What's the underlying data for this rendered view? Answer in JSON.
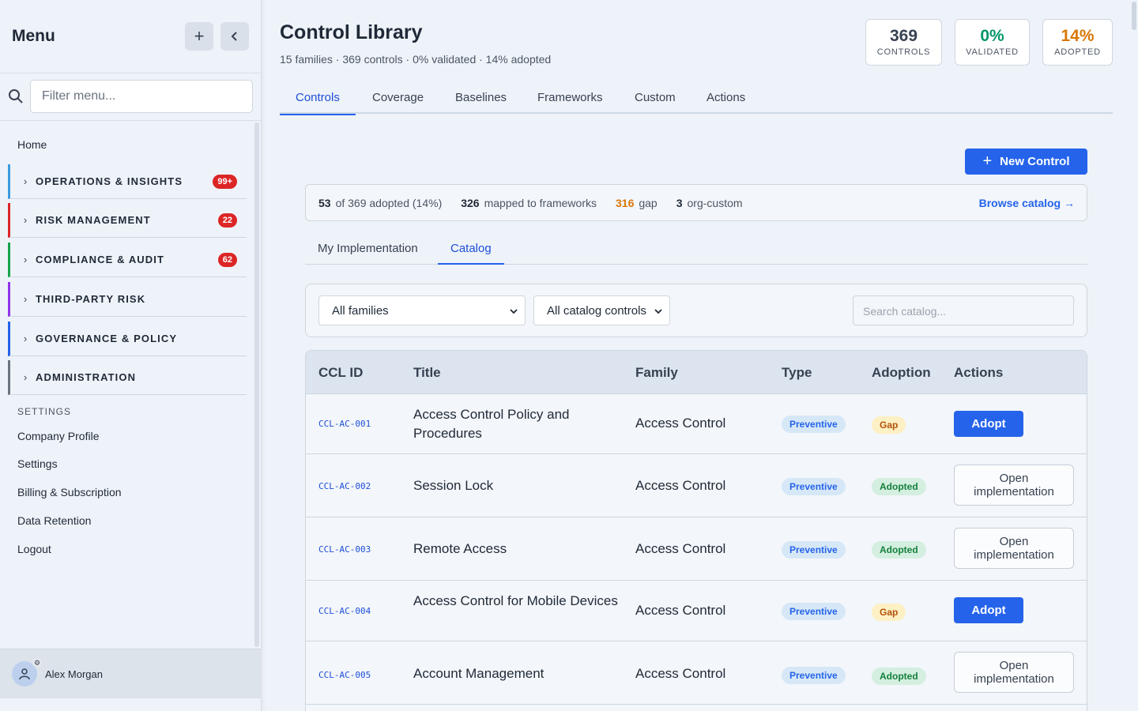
{
  "sidebar": {
    "title": "Menu",
    "add_label": "+",
    "collapse_label": "‹",
    "search_placeholder": "Filter menu...",
    "home": "Home",
    "groups": [
      {
        "label": "OPERATIONS & INSIGHTS",
        "badge": "99+",
        "color": "#3b9be0"
      },
      {
        "label": "RISK MANAGEMENT",
        "badge": "22",
        "color": "#dc2626"
      },
      {
        "label": "COMPLIANCE & AUDIT",
        "badge": "62",
        "color": "#16a34a"
      },
      {
        "label": "THIRD-PARTY RISK",
        "badge": "",
        "color": "#9333ea"
      },
      {
        "label": "GOVERNANCE & POLICY",
        "badge": "",
        "color": "#2563eb"
      },
      {
        "label": "ADMINISTRATION",
        "badge": "",
        "color": "#6b7280"
      }
    ],
    "settings_label": "SETTINGS",
    "settings_items": [
      "Company Profile",
      "Settings",
      "Billing & Subscription",
      "Data Retention",
      "Logout"
    ],
    "user": "Alex Morgan"
  },
  "header": {
    "title": "Control Library",
    "subtitle": "15 families · 369 controls · 0% validated · 14% adopted",
    "stats": [
      {
        "value": "369",
        "label": "CONTROLS",
        "color": "#374151"
      },
      {
        "value": "0%",
        "label": "VALIDATED",
        "color": "#059669"
      },
      {
        "value": "14%",
        "label": "ADOPTED",
        "color": "#d97706"
      }
    ]
  },
  "tabs": [
    "Controls",
    "Coverage",
    "Baselines",
    "Frameworks",
    "Custom",
    "Actions"
  ],
  "active_tab": "Controls",
  "new_control_label": "New Control",
  "summary": {
    "adopted_num": "53",
    "adopted_text": "of 369 adopted (14%)",
    "mapped_num": "326",
    "mapped_text": "mapped to frameworks",
    "gap_num": "316",
    "gap_text": "gap",
    "custom_num": "3",
    "custom_text": "org-custom",
    "browse_label": "Browse catalog →"
  },
  "subtabs": [
    "My Implementation",
    "Catalog"
  ],
  "active_subtab": "Catalog",
  "filters": {
    "family": "All families",
    "controls": "All catalog controls",
    "search_placeholder": "Search catalog..."
  },
  "table": {
    "columns": [
      "CCL ID",
      "Title",
      "Family",
      "Type",
      "Adoption",
      "Actions"
    ],
    "rows": [
      {
        "id": "CCL-AC-001",
        "title": "Access Control Policy and Procedures",
        "family": "Access Control",
        "type": "Preventive",
        "adoption": "Gap",
        "action": "Adopt"
      },
      {
        "id": "CCL-AC-002",
        "title": "Session Lock",
        "family": "Access Control",
        "type": "Preventive",
        "adoption": "Adopted",
        "action": "Open implementation"
      },
      {
        "id": "CCL-AC-003",
        "title": "Remote Access",
        "family": "Access Control",
        "type": "Preventive",
        "adoption": "Adopted",
        "action": "Open implementation"
      },
      {
        "id": "CCL-AC-004",
        "title": "Access Control for Mobile Devices",
        "family": "Access Control",
        "type": "Preventive",
        "adoption": "Gap",
        "action": "Adopt"
      },
      {
        "id": "CCL-AC-005",
        "title": "Account Management",
        "family": "Access Control",
        "type": "Preventive",
        "adoption": "Adopted",
        "action": "Open implementation"
      }
    ]
  }
}
